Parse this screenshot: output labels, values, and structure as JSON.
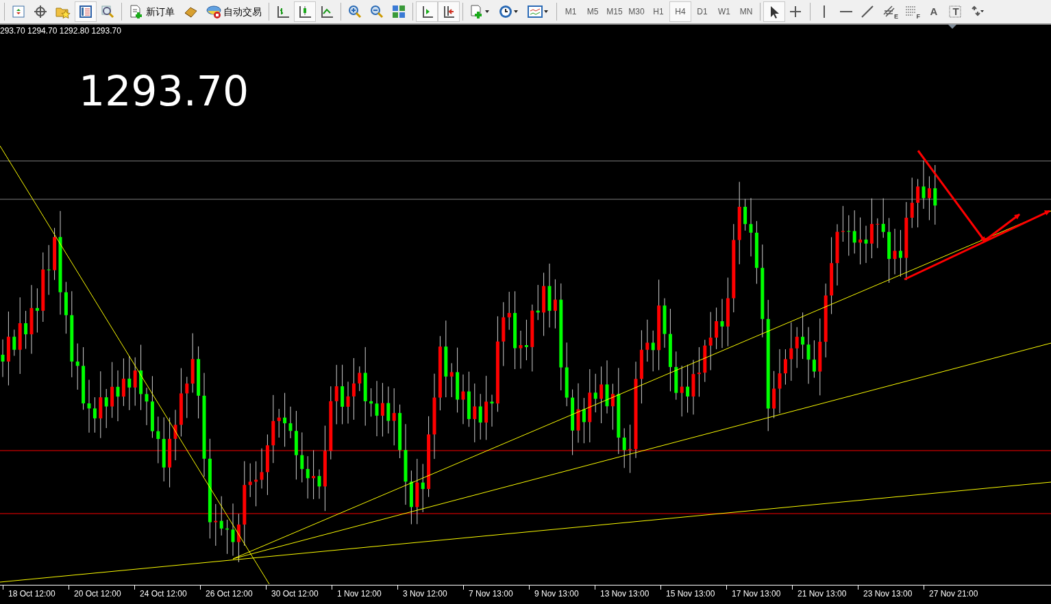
{
  "toolbar": [
    {
      "pressed": false
    },
    {
      "pressed": false
    },
    {
      "pressed": false
    },
    {
      "pressed": true
    },
    {
      "pressed": false
    },
    {
      "label": "新订单",
      "pressed": false
    },
    {
      "pressed": false
    },
    {
      "label": "自动交易",
      "pressed": false
    },
    {
      "pressed": false
    },
    {
      "pressed": true
    },
    {
      "pressed": false
    },
    {
      "pressed": false
    },
    {
      "pressed": false
    },
    {
      "pressed": false
    },
    {
      "pressed": true
    },
    {
      "pressed": true
    },
    {
      "pressed": false
    },
    {
      "pressed": false
    },
    {
      "pressed": false
    }
  ],
  "timeframes": [
    {
      "label": "M1",
      "selected": false
    },
    {
      "label": "M5",
      "selected": false
    },
    {
      "label": "M15",
      "selected": false
    },
    {
      "label": "M30",
      "selected": false
    },
    {
      "label": "H1",
      "selected": false
    },
    {
      "label": "H4",
      "selected": true
    },
    {
      "label": "D1",
      "selected": false
    },
    {
      "label": "W1",
      "selected": false
    },
    {
      "label": "MN",
      "selected": false
    }
  ],
  "drawing_tools": [
    {
      "pressed": true
    },
    {
      "pressed": false
    },
    {
      "pressed": false
    },
    {
      "pressed": false
    },
    {
      "pressed": false
    },
    {
      "pressed": false,
      "glyph": "E"
    },
    {
      "pressed": false,
      "glyph": "F"
    },
    {
      "pressed": false,
      "glyph": "A"
    },
    {
      "pressed": false,
      "glyph": "T"
    },
    {
      "pressed": false
    }
  ],
  "chart": {
    "ohlc": "293.70 1294.70 1292.80 1293.70",
    "price": "1293.70",
    "time_axis": [
      "18 Oct 12:00",
      "20 Oct 12:00",
      "24 Oct 12:00",
      "26 Oct 12:00",
      "30 Oct 12:00",
      "1 Nov 12:00",
      "3 Nov 12:00",
      "7 Nov 13:00",
      "9 Nov 13:00",
      "13 Nov 13:00",
      "15 Nov 13:00",
      "17 Nov 13:00",
      "21 Nov 13:00",
      "23 Nov 13:00",
      "27 Nov 21:00"
    ]
  }
}
